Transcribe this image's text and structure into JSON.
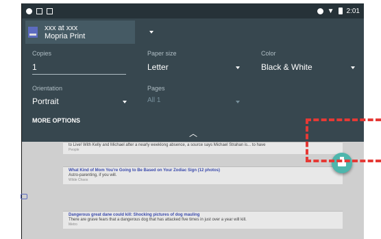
{
  "status_bar": {
    "time": "2:01",
    "left_icons": [
      "notification-icon",
      "screen-icon",
      "sdcard-icon"
    ],
    "right_icons": [
      "sync-icon",
      "wifi-icon",
      "battery-icon"
    ]
  },
  "printer": {
    "line1": "xxx at xxx",
    "line2": "Mopria Print"
  },
  "copies": {
    "label": "Copies",
    "value": "1"
  },
  "paper_size": {
    "label": "Paper size",
    "value": "Letter"
  },
  "color": {
    "label": "Color",
    "value": "Black & White"
  },
  "orientation": {
    "label": "Orientation",
    "value": "Portrait"
  },
  "pages": {
    "label": "Pages",
    "value": "All 1"
  },
  "more_options": "MORE OPTIONS",
  "articles": [
    {
      "title": "",
      "body": "to Live! With Kelly and Michael after a nearly weeklong absence, a source says Michael Strahan is... to have",
      "meta": "People"
    },
    {
      "title": "What Kind of Mom You're Going to Be Based on Your Zodiac Sign (12 photos)",
      "body": "Astro-parenting, if you will.",
      "meta": "Wilde Chaos"
    },
    {
      "title": "Dangerous great dane could kill: Shocking pictures of dog mauling",
      "body": "There are grave fears that a dangerous dog that has attacked five times in just over a year will kill.",
      "meta": "Metro"
    }
  ],
  "colors": {
    "panel": "#37474f",
    "status": "#263238",
    "fab": "#4db6ac",
    "annotation": "#e53935"
  }
}
